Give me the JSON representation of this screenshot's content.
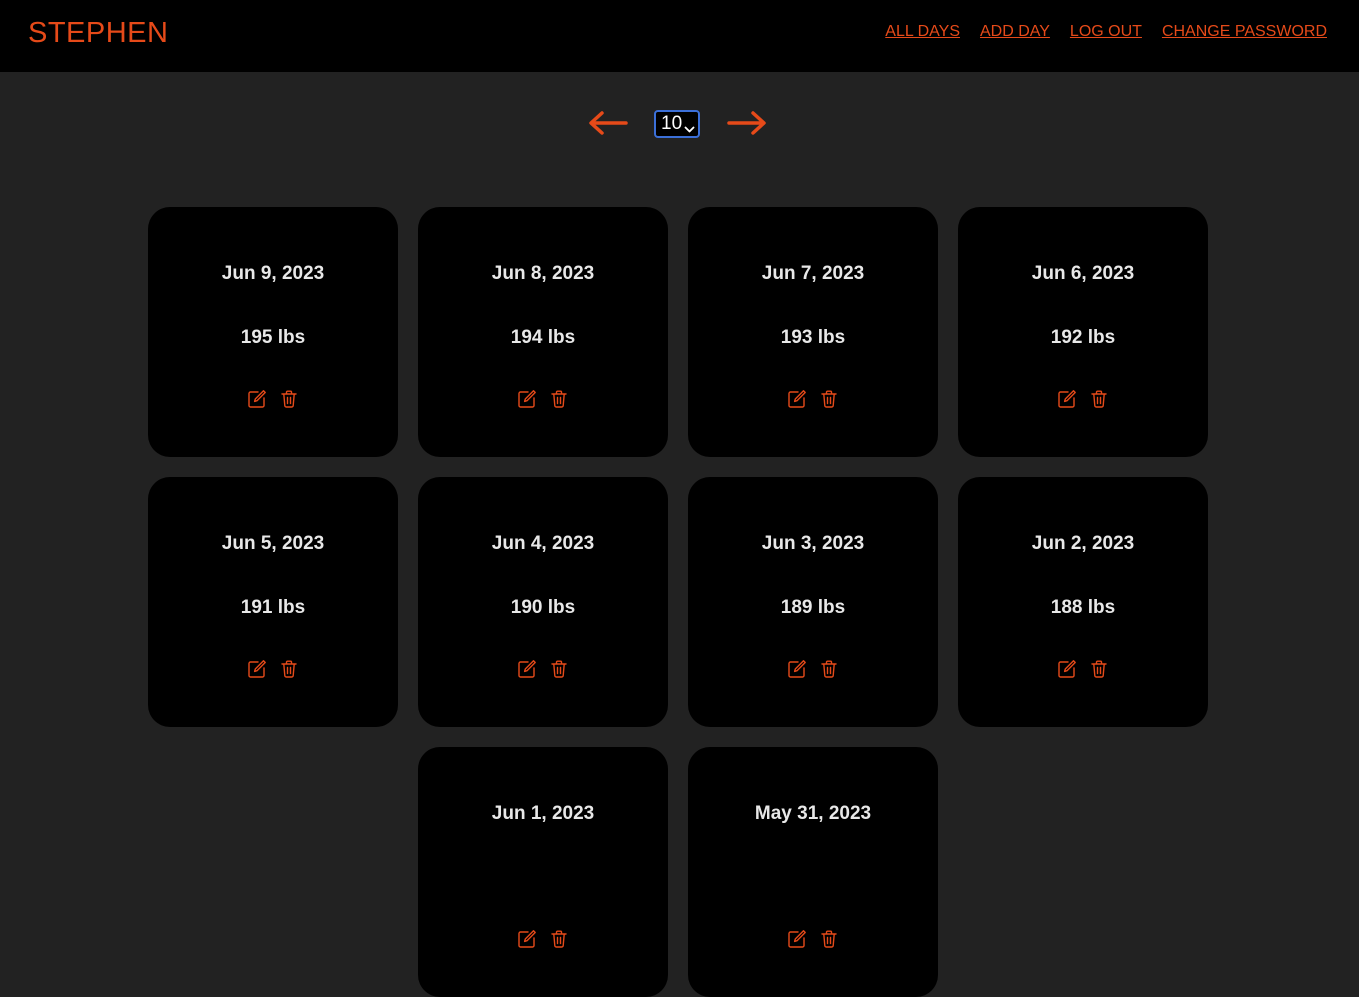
{
  "header": {
    "brand": "STEPHEN",
    "nav": [
      "ALL DAYS",
      "ADD DAY",
      "LOG OUT",
      "CHANGE PASSWORD"
    ]
  },
  "pager": {
    "selected": "10",
    "prev_icon": "arrow-left-icon",
    "next_icon": "arrow-right-icon"
  },
  "days": [
    {
      "date": "Jun 9, 2023",
      "weight": "195 lbs"
    },
    {
      "date": "Jun 8, 2023",
      "weight": "194 lbs"
    },
    {
      "date": "Jun 7, 2023",
      "weight": "193 lbs"
    },
    {
      "date": "Jun 6, 2023",
      "weight": "192 lbs"
    },
    {
      "date": "Jun 5, 2023",
      "weight": "191 lbs"
    },
    {
      "date": "Jun 4, 2023",
      "weight": "190 lbs"
    },
    {
      "date": "Jun 3, 2023",
      "weight": "189 lbs"
    },
    {
      "date": "Jun 2, 2023",
      "weight": "188 lbs"
    },
    {
      "date": "Jun 1, 2023",
      "weight": ""
    },
    {
      "date": "May 31, 2023",
      "weight": ""
    }
  ],
  "colors": {
    "accent": "#e64a19",
    "page_bg": "#222222",
    "card_bg": "#000000",
    "text": "#e8e8e8",
    "select_border": "#3b6fd8"
  }
}
